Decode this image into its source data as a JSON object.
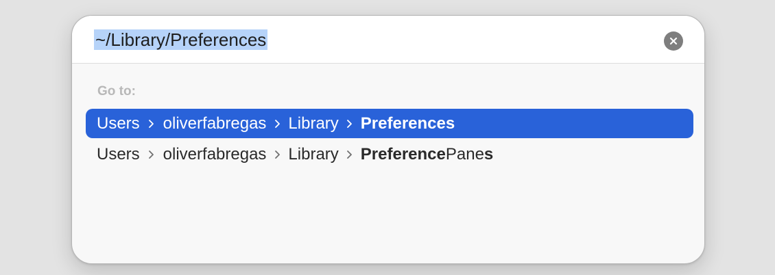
{
  "search": {
    "value": "~/Library/Preferences",
    "clear_icon": "close-circle-icon"
  },
  "section": {
    "label": "Go to:"
  },
  "results": [
    {
      "segments": [
        "Users",
        "oliverfabregas",
        "Library"
      ],
      "last_bold": "Preferences",
      "last_rest": "",
      "last_trailing_bold": "",
      "selected": true
    },
    {
      "segments": [
        "Users",
        "oliverfabregas",
        "Library"
      ],
      "last_bold": "Preference",
      "last_rest": "Pane",
      "last_trailing_bold": "s",
      "selected": false
    }
  ],
  "separator_icon": "chevron-right-icon",
  "colors": {
    "selection_highlight": "#2962d9",
    "text_selection": "#b6d3f9",
    "clear_button": "#7e7e7e"
  }
}
